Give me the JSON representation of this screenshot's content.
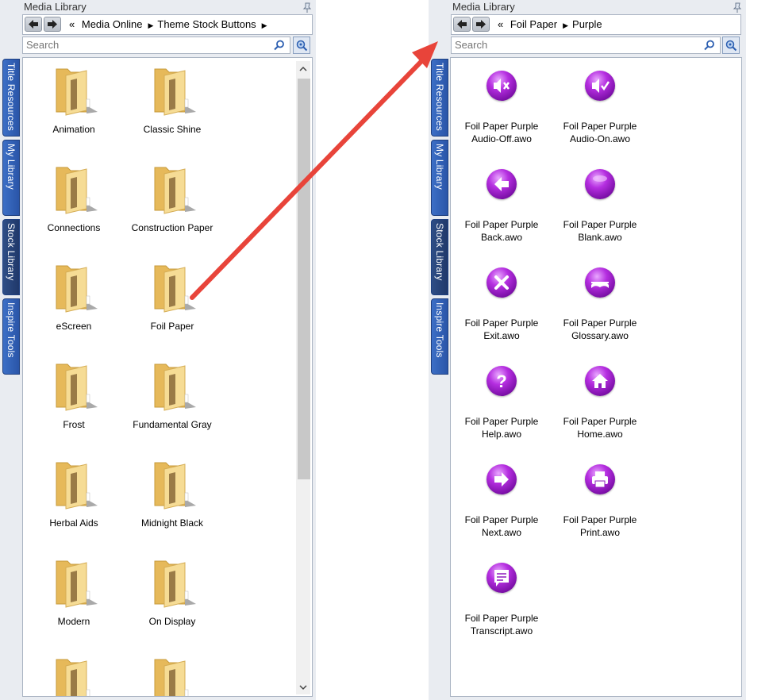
{
  "left": {
    "title": "Media Library",
    "breadcrumb": [
      "Media Online",
      "Theme Stock Buttons"
    ],
    "search_placeholder": "Search",
    "side_tabs": [
      "Title Resources",
      "My Library",
      "Stock Library",
      "Inspire Tools"
    ],
    "items": [
      "Animation",
      "Classic Shine",
      "Connections",
      "Construction Paper",
      "eScreen",
      "Foil Paper",
      "Frost",
      "Fundamental Gray",
      "Herbal Aids",
      "Midnight Black",
      "Modern",
      "On Display",
      "",
      ""
    ]
  },
  "right": {
    "title": "Media Library",
    "breadcrumb": [
      "Foil Paper",
      "Purple"
    ],
    "search_placeholder": "Search",
    "side_tabs": [
      "Title Resources",
      "My Library",
      "Stock Library",
      "Inspire Tools"
    ],
    "items": [
      {
        "line1": "Foil Paper Purple",
        "line2": "Audio-Off.awo",
        "icon": "speaker-mute-icon"
      },
      {
        "line1": "Foil Paper Purple",
        "line2": "Audio-On.awo",
        "icon": "speaker-check-icon"
      },
      {
        "line1": "Foil Paper Purple",
        "line2": "Back.awo",
        "icon": "back-arrow-icon"
      },
      {
        "line1": "Foil Paper Purple",
        "line2": "Blank.awo",
        "icon": "blank-icon"
      },
      {
        "line1": "Foil Paper Purple",
        "line2": "Exit.awo",
        "icon": "exit-x-icon"
      },
      {
        "line1": "Foil Paper Purple",
        "line2": "Glossary.awo",
        "icon": "book-icon"
      },
      {
        "line1": "Foil Paper Purple",
        "line2": "Help.awo",
        "icon": "question-icon"
      },
      {
        "line1": "Foil Paper Purple",
        "line2": "Home.awo",
        "icon": "home-icon"
      },
      {
        "line1": "Foil Paper Purple",
        "line2": "Next.awo",
        "icon": "next-arrow-icon"
      },
      {
        "line1": "Foil Paper Purple",
        "line2": "Print.awo",
        "icon": "printer-icon"
      },
      {
        "line1": "Foil Paper Purple",
        "line2": "Transcript.awo",
        "icon": "transcript-icon"
      }
    ]
  },
  "colors": {
    "accent_purple": "#9b1fd0",
    "arrow_red": "#e8443a",
    "tab_blue": "#3563b8",
    "folder_yellow": "#f2d27e"
  }
}
